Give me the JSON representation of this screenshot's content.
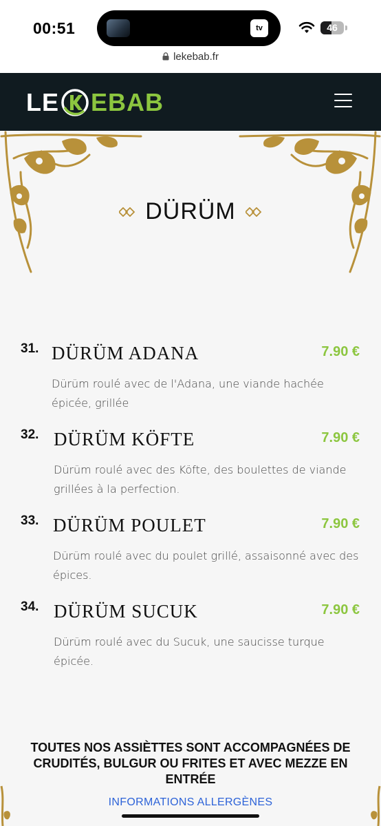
{
  "status_bar": {
    "time": "00:51",
    "island_badge": "tv",
    "battery": "46",
    "battery_level": 0.46
  },
  "browser": {
    "url": "lekebab.fr"
  },
  "header": {
    "logo_left": "LE",
    "logo_letter": "K",
    "logo_right": "EBAB",
    "brand_color": "#8cc63f",
    "background": "#101b20"
  },
  "section": {
    "title": "DÜRÜM"
  },
  "menu_items": [
    {
      "number": "31.",
      "name": "DÜRÜM ADANA",
      "price": "7.90 €",
      "description": "Dürüm roulé avec de l'Adana, une viande hachée épicée, grillée"
    },
    {
      "number": "32.",
      "name": "DÜRÜM KÖFTE",
      "price": "7.90 €",
      "description": "Dürüm roulé avec des Köfte, des boulettes de viande grillées à la perfection."
    },
    {
      "number": "33.",
      "name": "DÜRÜM POULET",
      "price": "7.90 €",
      "description": "Dürüm roulé avec du poulet grillé, assaisonné avec des épices."
    },
    {
      "number": "34.",
      "name": "DÜRÜM SUCUK",
      "price": "7.90 €",
      "description": "Dürüm roulé avec du Sucuk, une saucisse turque épicée."
    }
  ],
  "footer": {
    "note": "TOUTES NOS ASSIÈTTES SONT ACCOMPAGNÉES DE CRUDITÉS, BULGUR OU FRITES ET AVEC MEZZE EN ENTRÉE",
    "allergen_link": "INFORMATIONS ALLERGÈNES"
  },
  "colors": {
    "price": "#8cc63f",
    "link": "#2d63d8",
    "ornament": "#b8913a"
  }
}
